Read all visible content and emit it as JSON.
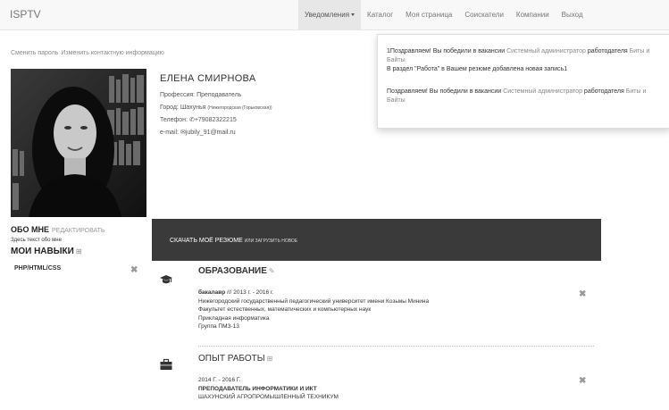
{
  "navbar": {
    "brand": "ISPTV",
    "items": [
      {
        "label": "Уведомления",
        "active": true
      },
      {
        "label": "Каталог"
      },
      {
        "label": "Моя страница"
      },
      {
        "label": "Соискатели"
      },
      {
        "label": "Компании"
      },
      {
        "label": "Выход"
      }
    ]
  },
  "top_links": {
    "change_password": "Сменить пароль",
    "change_contact": "Изменить контактную информацию"
  },
  "notifications": {
    "n1_prefix": "1Поздравляем! Вы победили в вакансии",
    "n1_vacancy": "Системный администратор",
    "n1_mid": "работодателя",
    "n1_company": "Биты и Байты",
    "n2": "В раздел \"Работа\" в Вашем резюме добавлена новая запись1",
    "n3_prefix": "Поздравляем! Вы победили в вакансии",
    "n3_vacancy": "Системный администратор",
    "n3_mid": "работодателя",
    "n3_company": "Биты и Байты"
  },
  "profile": {
    "name": "ЕЛЕНА СМИРНОВА",
    "profession_label": "Профессия:",
    "profession": "Преподаватель",
    "city_label": "Город:",
    "city": "Шахунья",
    "city_region": "(Нижегородская (Горьковская))",
    "phone_label": "Телефон:",
    "phone": "+79082322215",
    "email_label": "e-mail:",
    "email": "jubily_91@mail.ru"
  },
  "about": {
    "title": "ОБО МНЕ",
    "edit": "РЕДАКТИРОВАТЬ",
    "text": "Здесь текст обо мне",
    "skills_title": "МОИ НАВЫКИ",
    "skills": [
      "PHP/HTML/CSS"
    ]
  },
  "resume_bar": {
    "download": "СКАЧАТЬ МОЁ РЕЗЮМЕ",
    "or_upload": "ИЛИ ЗАГРУЗИТЬ НОВОЕ"
  },
  "education": {
    "title": "ОБРАЗОВАНИЕ",
    "degree": "бакалавр",
    "period": "/// 2013 г. - 2016 г.",
    "university": "Нижегородский государственный педагогический университет имени Козьмы Минина",
    "faculty": "Факультет естественных, математических и компьютерных наук",
    "major": "Прикладная информатика",
    "group": "Группа ПМЗ-13"
  },
  "work": {
    "title": "ОПЫТ РАБОТЫ",
    "period": "2014 Г. - 2016 Г.",
    "position": "ПРЕПОДАВАТЕЛЬ ИНФОРМАТИКИ И ИКТ",
    "company": "ШАХУНСКИЙ АГРОПРОМЫШЛЕННЫЙ ТЕХНИКУМ"
  },
  "icons": {
    "phone": "phone-icon",
    "email": "envelope-icon",
    "education": "graduation-cap-icon",
    "work": "briefcase-icon",
    "remove": "close-icon"
  }
}
